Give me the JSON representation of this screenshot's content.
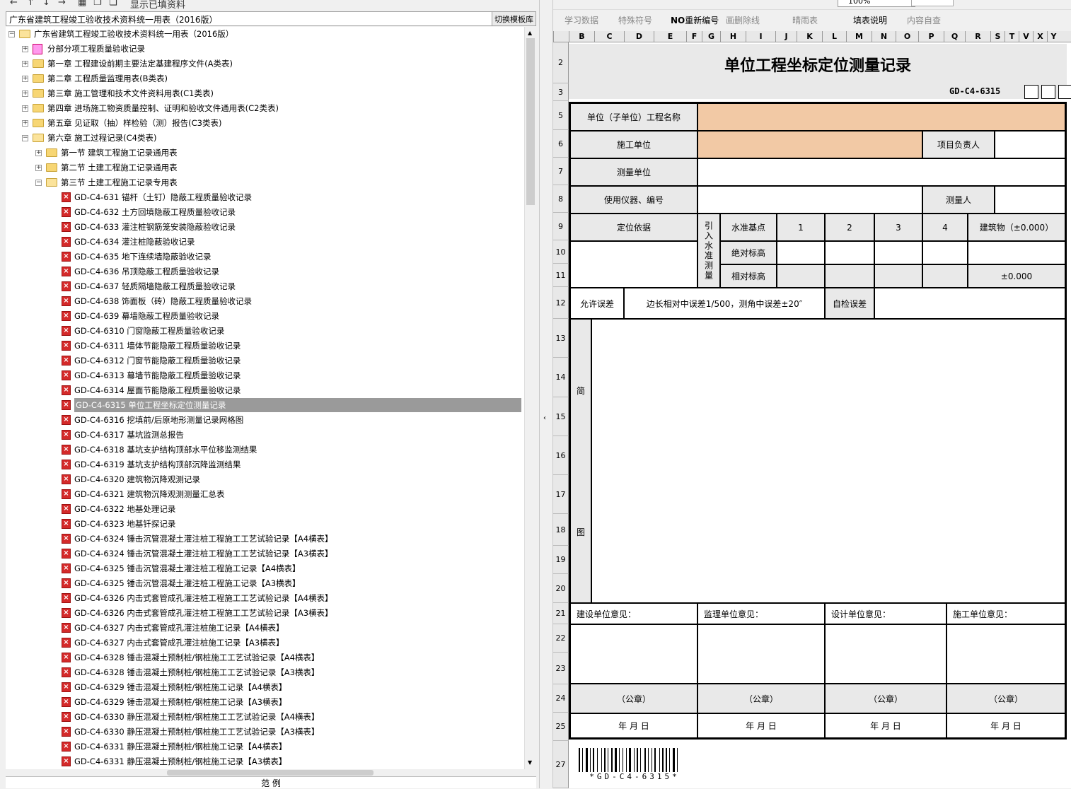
{
  "left_toolbar": {
    "show_filled": "显示已填资料"
  },
  "left_panel": {
    "header_title": "广东省建筑工程竣工验收技术资料统一用表（2016版）",
    "switch_button": "切换模板库",
    "footer": "范    例"
  },
  "tree": {
    "root": "广东省建筑工程竣工验收技术资料统一用表（2016版）",
    "level1": [
      "分部分项工程质量验收记录",
      "第一章 工程建设前期主要法定基建程序文件(A类表)",
      "第二章 工程质量监理用表(B类表)",
      "第三章 施工管理和技术文件资料用表(C1类表)",
      "第四章 进场施工物资质量控制、证明和验收文件通用表(C2类表)",
      "第五章  见证取（抽）样检验（测）报告(C3类表)",
      "第六章 施工过程记录(C4类表)"
    ],
    "sections": [
      "第一节 建筑工程施工记录通用表",
      "第二节 土建工程施工记录通用表",
      "第三节 土建工程施工记录专用表"
    ],
    "items": [
      "GD-C4-631 锚杆（土钉）隐蔽工程质量验收记录",
      "GD-C4-632 土方回填隐蔽工程质量验收记录",
      "GD-C4-633 灌注桩钢筋笼安装隐蔽验收记录",
      "GD-C4-634 灌注桩隐蔽验收记录",
      "GD-C4-635 地下连续墙隐蔽验收记录",
      "GD-C4-636 吊顶隐蔽工程质量验收记录",
      "GD-C4-637 轻质隔墙隐蔽工程质量验收记录",
      "GD-C4-638 饰面板（砖）隐蔽工程质量验收记录",
      "GD-C4-639 幕墙隐蔽工程质量验收记录",
      "GD-C4-6310 门窗隐蔽工程质量验收记录",
      "GD-C4-6311 墙体节能隐蔽工程质量验收记录",
      "GD-C4-6312 门窗节能隐蔽工程质量验收记录",
      "GD-C4-6313 幕墙节能隐蔽工程质量验收记录",
      "GD-C4-6314 屋面节能隐蔽工程质量验收记录",
      "GD-C4-6315 单位工程坐标定位测量记录",
      "GD-C4-6316 挖填前/后原地形测量记录网格图",
      "GD-C4-6317 基坑监测总报告",
      "GD-C4-6318 基坑支护结构顶部水平位移监测结果",
      "GD-C4-6319 基坑支护结构顶部沉降监测结果",
      "GD-C4-6320 建筑物沉降观测记录",
      "GD-C4-6321 建筑物沉降观测测量汇总表",
      "GD-C4-6322 地基处理记录",
      "GD-C4-6323 地基钎探记录",
      "GD-C4-6324 锤击沉管混凝土灌注桩工程施工工艺试验记录【A4横表】",
      "GD-C4-6324 锤击沉管混凝土灌注桩工程施工工艺试验记录【A3横表】",
      "GD-C4-6325 锤击沉管混凝土灌注桩工程施工记录【A4横表】",
      "GD-C4-6325 锤击沉管混凝土灌注桩工程施工记录【A3横表】",
      "GD-C4-6326 内击式套管成孔灌注桩工程施工工艺试验记录【A4横表】",
      "GD-C4-6326 内击式套管成孔灌注桩工程施工工艺试验记录【A3横表】",
      "GD-C4-6327 内击式套管成孔灌注桩施工记录【A4横表】",
      "GD-C4-6327 内击式套管成孔灌注桩施工记录【A3横表】",
      "GD-C4-6328 锤击混凝土预制桩/钢桩施工工艺试验记录【A4横表】",
      "GD-C4-6328 锤击混凝土预制桩/钢桩施工工艺试验记录【A3横表】",
      "GD-C4-6329 锤击混凝土预制桩/钢桩施工记录【A4横表】",
      "GD-C4-6329 锤击混凝土预制桩/钢桩施工记录【A3横表】",
      "GD-C4-6330 静压混凝土预制桩/钢桩施工工艺试验记录【A4横表】",
      "GD-C4-6330 静压混凝土预制桩/钢桩施工工艺试验记录【A3横表】",
      "GD-C4-6331 静压混凝土预制桩/钢桩施工记录【A4横表】",
      "GD-C4-6331 静压混凝土预制桩/钢桩施工记录【A3横表】"
    ]
  },
  "right_toolbar": {
    "zoom": "100%",
    "buttons": [
      "学习数据",
      "特殊符号",
      "重新编号",
      "画删除线",
      "晴雨表",
      "填表说明",
      "内容自查"
    ],
    "renumber_prefix": "NO"
  },
  "columns": [
    "B",
    "C",
    "D",
    "E",
    "F",
    "G",
    "H",
    "I",
    "J",
    "K",
    "L",
    "M",
    "N",
    "O",
    "P",
    "Q",
    "R",
    "S",
    "T",
    "V",
    "X",
    "Y"
  ],
  "rows": [
    "2",
    "3",
    "5",
    "6",
    "7",
    "8",
    "9",
    "10",
    "11",
    "12",
    "13",
    "14",
    "15",
    "16",
    "17",
    "18",
    "19",
    "20",
    "21",
    "22",
    "23",
    "24",
    "25",
    "27"
  ],
  "form": {
    "title": "单位工程坐标定位测量记录",
    "code": "GD-C4-6315",
    "project_name_label": "单位（子单位）工程名称",
    "construction_unit_label": "施工单位",
    "project_manager_label": "项目负责人",
    "survey_unit_label": "测量单位",
    "instrument_label": "使用仪器、编号",
    "surveyor_label": "测量人",
    "basis_label": "定位依据",
    "leveling_label": "引入水准测量",
    "benchmark_label": "水准基点",
    "points": [
      "1",
      "2",
      "3",
      "4"
    ],
    "building_label": "建筑物（±0.000）",
    "absolute_label": "绝对标高",
    "relative_label": "相对标高",
    "relative_value": "±0.000",
    "tolerance_label": "允许误差",
    "tolerance_value": "边长相对中误差1/500，测角中误差±20″",
    "self_check_label": "自检误差",
    "sketch_label_1": "简",
    "sketch_label_2": "图",
    "opinions": [
      "建设单位意见：",
      "监理单位意见：",
      "设计单位意见：",
      "施工单位意见："
    ],
    "seal": "（公章）",
    "date": "年    月    日",
    "barcode_text": "*GD-C4-6315*"
  }
}
